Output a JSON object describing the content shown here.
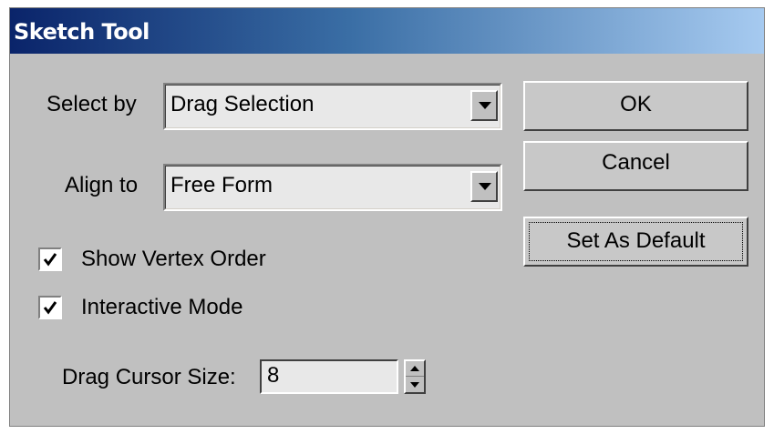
{
  "window": {
    "title": "Sketch Tool"
  },
  "select_by": {
    "label": "Select by",
    "value": "Drag Selection"
  },
  "align_to": {
    "label": "Align to",
    "value": "Free Form"
  },
  "options": {
    "show_vertex_order": {
      "label": "Show Vertex Order",
      "checked": true
    },
    "interactive_mode": {
      "label": "Interactive Mode",
      "checked": true
    }
  },
  "drag_cursor_size": {
    "label": "Drag Cursor Size:",
    "value": "8"
  },
  "buttons": {
    "ok": "OK",
    "cancel": "Cancel",
    "set_as_default": "Set As Default"
  },
  "icons": {
    "combo_arrow": "chevron-down-icon",
    "checkmark": "check-icon",
    "spin_up": "triangle-up-icon",
    "spin_down": "triangle-down-icon"
  }
}
